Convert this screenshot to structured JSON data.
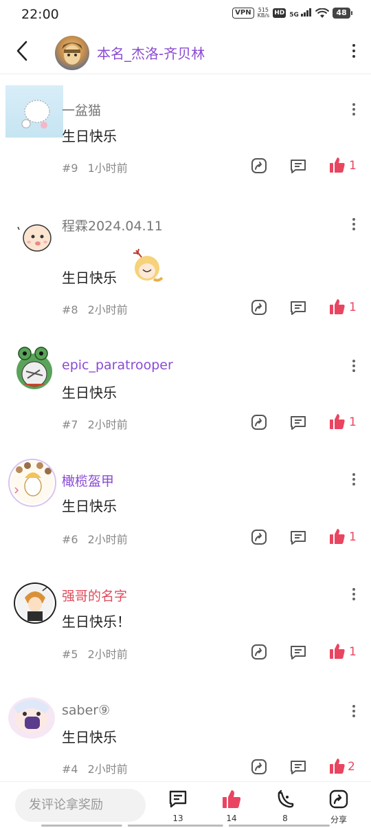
{
  "status": {
    "time": "22:00",
    "vpn": "VPN",
    "speed_value": "515",
    "speed_unit": "KB/s",
    "hd": "HD",
    "network": "5G",
    "battery": "48"
  },
  "header": {
    "title": "本名_杰洛-齐贝林"
  },
  "colors": {
    "accent_purple": "#8a4bd4",
    "like_red": "#e94561",
    "name_red": "#e04b5b",
    "name_gray": "#777777"
  },
  "comments": [
    {
      "name": "一盆猫",
      "text": "生日快乐",
      "floor": "#9",
      "time": "1小时前",
      "likes": "1",
      "name_color": "gray"
    },
    {
      "name": "程霖2024.04.11",
      "text": "生日快乐",
      "floor": "#8",
      "time": "2小时前",
      "likes": "1",
      "name_color": "gray",
      "sticker": "anime-sticker"
    },
    {
      "name": "epic_paratrooper",
      "text": "生日快乐",
      "floor": "#7",
      "time": "2小时前",
      "likes": "1",
      "name_color": "purple"
    },
    {
      "name": "橄榄盔甲",
      "text": "生日快乐",
      "floor": "#6",
      "time": "2小时前",
      "likes": "1",
      "name_color": "purple"
    },
    {
      "name": "强哥的名字",
      "text": "生日快乐！",
      "floor": "#5",
      "time": "2小时前",
      "likes": "1",
      "name_color": "red"
    },
    {
      "name": "saber⑨",
      "text": "生日快乐",
      "floor": "#4",
      "time": "2小时前",
      "likes": "2",
      "name_color": "gray"
    }
  ],
  "bottom_bar": {
    "input_placeholder": "发评论拿奖励",
    "comments_count": "13",
    "likes_count": "14",
    "bananas_count": "8",
    "share_label": "分享"
  }
}
